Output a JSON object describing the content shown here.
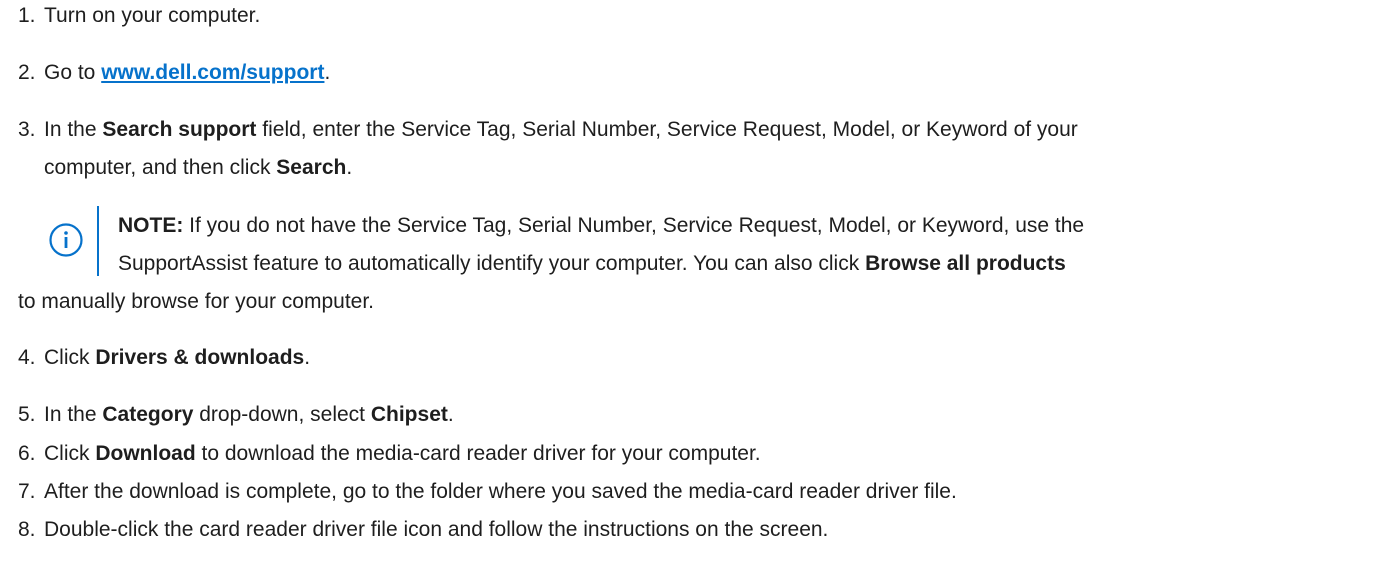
{
  "colors": {
    "text": "#1e1e1e",
    "link": "#0672cb",
    "note_accent": "#0672cb"
  },
  "steps": [
    {
      "num": "1.",
      "parts": [
        "Turn on your computer."
      ]
    },
    {
      "num": "2.",
      "pre": "Go to ",
      "link": "www.dell.com/support",
      "post": "."
    },
    {
      "num": "3.",
      "pre": "In the ",
      "b1": "Search support",
      "mid": " field, enter the Service Tag, Serial Number, Service Request, Model, or Keyword of your",
      "cont_pre": "computer, and then click ",
      "b2": "Search",
      "cont_post": "."
    },
    {
      "num": "4.",
      "pre": "Click ",
      "b1": "Drivers & downloads",
      "post": "."
    },
    {
      "num": "5.",
      "pre": "In the ",
      "b1": "Category",
      "mid": " drop-down, select ",
      "b2": "Chipset",
      "post": "."
    },
    {
      "num": "6.",
      "pre": "Click ",
      "b1": "Download",
      "post": " to download the media-card reader driver for your computer."
    },
    {
      "num": "7.",
      "text": "After the download is complete, go to the folder where you saved the media-card reader driver file."
    },
    {
      "num": "8.",
      "text": "Double-click the card reader driver file icon and follow the instructions on the screen."
    }
  ],
  "note": {
    "icon": "info-icon",
    "label": "NOTE:",
    "line1": " If you do not have the Service Tag, Serial Number, Service Request, Model, or Keyword, use the",
    "line2_pre": "SupportAssist feature to automatically identify your computer. You can also click ",
    "line2_bold": "Browse all products",
    "line3": "to manually browse for your computer."
  }
}
